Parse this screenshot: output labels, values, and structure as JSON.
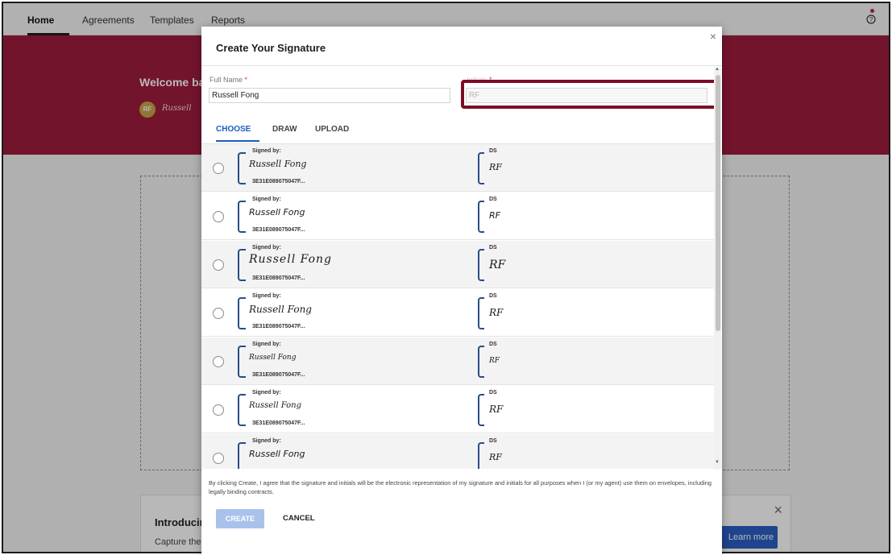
{
  "nav": {
    "home": "Home",
    "agreements": "Agreements",
    "templates": "Templates",
    "reports": "Reports",
    "help_icon": "help-circle-icon"
  },
  "banner": {
    "welcome": "Welcome ba",
    "avatar": "RF",
    "signature_preview": "Russell"
  },
  "promo": {
    "title": "Introducir",
    "text": "Capture the critical business value that's in your agreements with IAM",
    "button": "Learn more",
    "close": "×"
  },
  "modal": {
    "title": "Create Your Signature",
    "close": "×",
    "full_name_label": "Full Name",
    "full_name_value": "Russell Fong",
    "initials_label": "Initials",
    "initials_value": "RF",
    "required_mark": "*",
    "tabs": [
      "CHOOSE",
      "DRAW",
      "UPLOAD"
    ],
    "active_tab": "CHOOSE",
    "options": [
      {
        "signed_by": "Signed by:",
        "name": "Russell Fong",
        "id": "3E31E089075047F...",
        "ds": "DS",
        "initials": "RF"
      },
      {
        "signed_by": "Signed by:",
        "name": "Russell Fong",
        "id": "3E31E089075047F...",
        "ds": "DS",
        "initials": "RF"
      },
      {
        "signed_by": "Signed by:",
        "name": "Russell Fong",
        "id": "3E31E089075047F...",
        "ds": "DS",
        "initials": "RF"
      },
      {
        "signed_by": "Signed by:",
        "name": "Russell Fong",
        "id": "3E31E089075047F...",
        "ds": "DS",
        "initials": "RF"
      },
      {
        "signed_by": "Signed by:",
        "name": "Russell Fong",
        "id": "3E31E089075047F...",
        "ds": "DS",
        "initials": "RF"
      },
      {
        "signed_by": "Signed by:",
        "name": "Russell Fong",
        "id": "3E31E089075047F...",
        "ds": "DS",
        "initials": "RF"
      },
      {
        "signed_by": "Signed by:",
        "name": "Russell Fong",
        "id": "",
        "ds": "DS",
        "initials": "RF"
      }
    ],
    "consent": "By clicking Create, I agree that the signature and initials will be the electronic representation of my signature and initials for all purposes when I (or my agent) use them on envelopes, including legally binding contracts.",
    "create_button": "CREATE",
    "cancel_button": "CANCEL"
  },
  "colors": {
    "brand": "#a01d3f",
    "accent": "#1d5bbf",
    "highlight_box": "#7c0c24"
  }
}
